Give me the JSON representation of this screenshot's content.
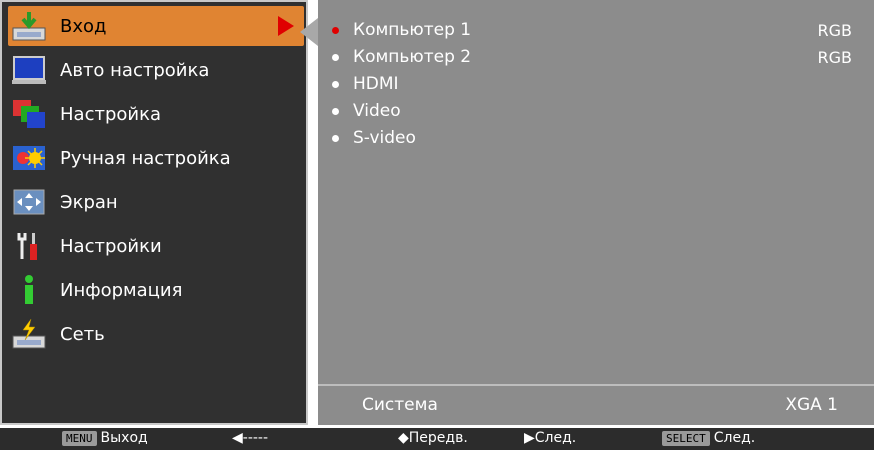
{
  "menu": {
    "items": [
      {
        "label": "Вход",
        "icon": "input-icon",
        "active": true
      },
      {
        "label": "Авто настройка",
        "icon": "auto-setup-icon"
      },
      {
        "label": "Настройка",
        "icon": "image-adjust-icon"
      },
      {
        "label": "Ручная настройка",
        "icon": "manual-adjust-icon"
      },
      {
        "label": "Экран",
        "icon": "screen-icon"
      },
      {
        "label": "Настройки",
        "icon": "tools-icon"
      },
      {
        "label": "Информация",
        "icon": "info-icon"
      },
      {
        "label": "Сеть",
        "icon": "network-icon"
      }
    ]
  },
  "sources": [
    {
      "label": "Компьютер 1",
      "signal": "RGB",
      "selected": true
    },
    {
      "label": "Компьютер 2",
      "signal": "RGB"
    },
    {
      "label": "HDMI",
      "signal": ""
    },
    {
      "label": "Video",
      "signal": ""
    },
    {
      "label": "S-video",
      "signal": ""
    }
  ],
  "system": {
    "label": "Система",
    "value": "XGA 1"
  },
  "hints": {
    "menu_key": "MENU",
    "exit": "Выход",
    "back": "◀-----",
    "move": "◆Передв.",
    "next": "▶След.",
    "select_key": "SELECT",
    "select_next": "След."
  },
  "colors": {
    "active": "#e08432",
    "panel_left": "#303030",
    "panel_right": "#8c8c8c",
    "selected_dot": "#e00000"
  }
}
